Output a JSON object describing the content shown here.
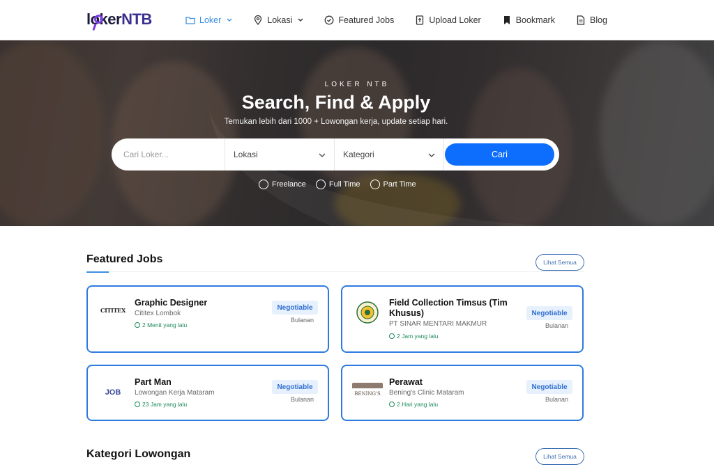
{
  "brand": {
    "part1": "loker",
    "part2": "NTB"
  },
  "nav": {
    "items": [
      {
        "label": "Loker",
        "icon": "folder-icon",
        "active": true,
        "has_dropdown": true
      },
      {
        "label": "Lokasi",
        "icon": "map-pin-icon",
        "active": false,
        "has_dropdown": true
      },
      {
        "label": "Featured Jobs",
        "icon": "check-circle-icon",
        "active": false,
        "has_dropdown": false
      },
      {
        "label": "Upload Loker",
        "icon": "upload-file-icon",
        "active": false,
        "has_dropdown": false
      },
      {
        "label": "Bookmark",
        "icon": "bookmark-icon",
        "active": false,
        "has_dropdown": false
      },
      {
        "label": "Blog",
        "icon": "document-icon",
        "active": false,
        "has_dropdown": false
      }
    ]
  },
  "hero": {
    "eyebrow": "LOKER NTB",
    "title": "Search, Find & Apply",
    "subtitle": "Temukan lebih dari 1000 + Lowongan kerja, update setiap hari.",
    "search": {
      "placeholder": "Cari Loker...",
      "location_value": "Lokasi",
      "category_value": "Kategori",
      "button_label": "Cari"
    },
    "job_types": [
      "Freelance",
      "Full Time",
      "Part Time"
    ]
  },
  "featured": {
    "title": "Featured Jobs",
    "see_all": "Lihat Semua",
    "jobs": [
      {
        "title": "Graphic Designer",
        "company": "Cititex Lombok",
        "posted": "2 Menit yang lalu",
        "salary": "Negotiable",
        "period": "Bulanan",
        "logo": "cititex-logo"
      },
      {
        "title": "Field Collection Timsus (Tim Khusus)",
        "company": "PT SINAR MENTARI MAKMUR",
        "posted": "2 Jam yang lalu",
        "salary": "Negotiable",
        "period": "Bulanan",
        "logo": "sinar-mentari-logo"
      },
      {
        "title": "Part Man",
        "company": "Lowongan Kerja Mataram",
        "posted": "23 Jam yang lalu",
        "salary": "Negotiable",
        "period": "Bulanan",
        "logo": "job-logo"
      },
      {
        "title": "Perawat",
        "company": "Bening's Clinic Mataram",
        "posted": "2 Hari yang lalu",
        "salary": "Negotiable",
        "period": "Bulanan",
        "logo": "benings-logo"
      }
    ]
  },
  "categories": {
    "title": "Kategori Lowongan",
    "see_all": "Lihat Semua"
  },
  "logo_text": {
    "cititex": "CITITEX",
    "job": "JOB",
    "benings": "BENING'S"
  },
  "colors": {
    "primary": "#0d6efd",
    "accent": "#3d8fe0",
    "card_border": "#2e7be0",
    "time": "#1a8a5a"
  }
}
